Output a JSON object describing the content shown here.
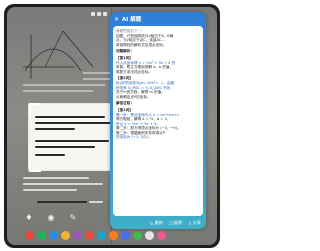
{
  "status": {
    "time": ""
  },
  "panel": {
    "title": "AI 解题",
    "intro": "解题思路如下 →",
    "lines": [
      "如图，已知抛物线与x轴交于A、B两",
      "点，与y轴交于点C，连接AC…",
      "求抛物线的解析式及顶点坐标。"
    ],
    "analysis_title": "问题解析：",
    "q1_label": "【第1问】",
    "q1_lines": [
      "代入点坐标得 y = ½x² + 3x + 4 的",
      "系数，联立方程组求解 a、b 的值，",
      "再配方求出顶点坐标。"
    ],
    "q2_label": "【第2问】",
    "q2_lines": [
      "设点P的坐标为(m, ½m²+…)，由面",
      "积关系 S△PAC = ¾ S△ABC 列出",
      "关于m的方程，解得 m 的值，",
      "从而确定点P的坐标。"
    ],
    "answer_title": "解答过程：",
    "a1_label": "【第1问】",
    "a1_lines": [
      "第一步：把点坐标代入 y = ax²+bx+c",
      "得方程组，解得 a = ½，b = 3，",
      "所以 y = ½x² + 3x + 4。",
      "第二步：配方得顶点坐标为 (−3, −½)。"
    ],
    "a2_lines": [
      "第二步：根据面积关系求得点P",
      "的坐标为 (−1, 3/2)。"
    ],
    "actions": {
      "refresh": "重新",
      "copy": "复制",
      "share": "分享"
    }
  },
  "colors": {
    "panel_top": "#2f7fd8",
    "panel_bottom": "#40b0c8",
    "math": "#1d5fb0"
  },
  "dock_apps": [
    "#e64a3c",
    "#22b45a",
    "#2b8ce6",
    "#f2b233",
    "#9b59b6",
    "#e64a3c",
    "#1fa2c9",
    "#ff7a1a",
    "#4b6cf0",
    "#3fb950",
    "#e6e6e6",
    "#f05b8d",
    "#7a7a7a"
  ]
}
